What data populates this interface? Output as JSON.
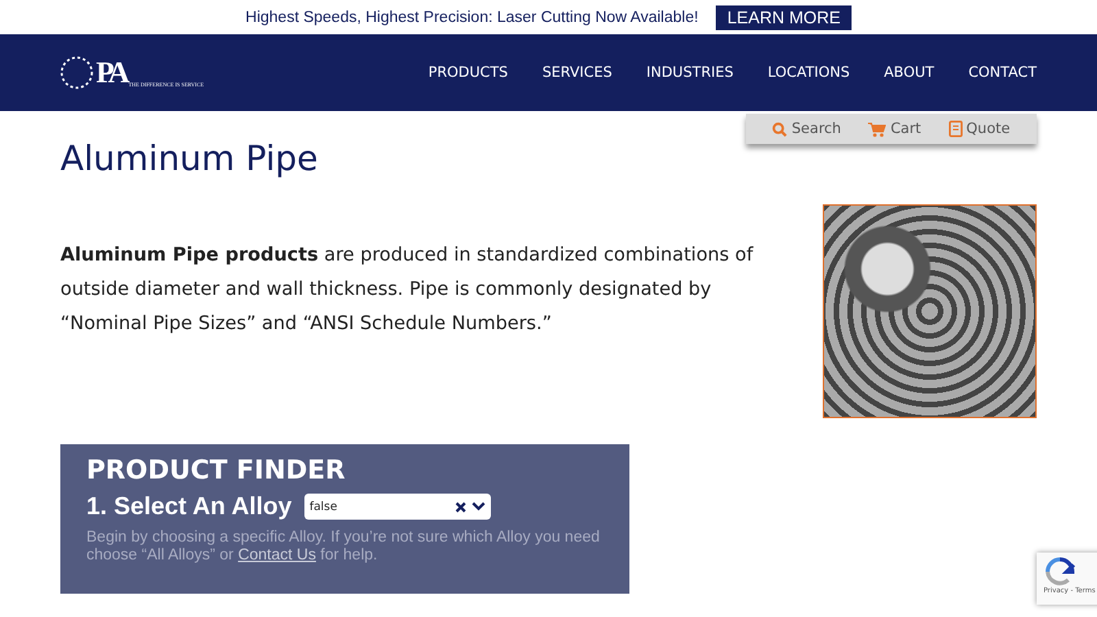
{
  "announcement": {
    "text": "Highest Speeds, Highest Precision: Laser Cutting Now Available!",
    "button": "LEARN MORE"
  },
  "logo": {
    "monogram": "PA",
    "tagline": "THE DIFFERENCE IS SERVICE"
  },
  "nav": {
    "items": [
      "PRODUCTS",
      "SERVICES",
      "INDUSTRIES",
      "LOCATIONS",
      "ABOUT",
      "CONTACT"
    ]
  },
  "utility": [
    {
      "kind": "search",
      "label": "Search"
    },
    {
      "kind": "cart",
      "label": "Cart"
    },
    {
      "kind": "quote",
      "label": "Quote"
    }
  ],
  "page": {
    "title": "Aluminum Pipe",
    "intro": "**Aluminum Pipe products** are produced in standardized combinations of outside diameter and wall thickness. Pipe is commonly designated by “Nominal Pipe Sizes” and “ANSI Schedule Numbers.”"
  },
  "finder": {
    "heading": "PRODUCT FINDER",
    "step": "1. Select An Alloy",
    "select_value": "false",
    "help_before": "Begin by choosing a specific Alloy. If you’re not sure which Alloy you need choose “All Alloys” or",
    "help_link": "Contact Us",
    "help_after": "for help."
  },
  "recaptcha": {
    "links": "Privacy - Terms"
  }
}
